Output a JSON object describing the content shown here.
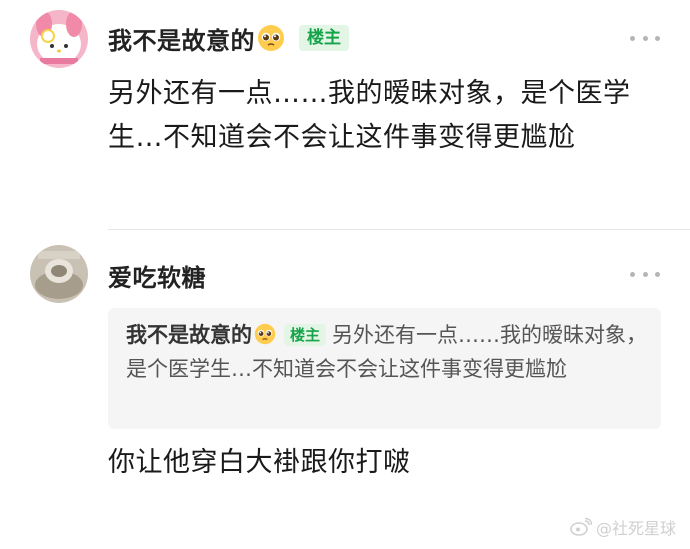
{
  "comments": [
    {
      "username": "我不是故意的",
      "emoji": "pleading-face",
      "badge": "楼主",
      "text": "另外还有一点……我的暧昧对象，是个医学生…不知道会不会让这件事变得更尴尬"
    },
    {
      "username": "爱吃软糖",
      "quote": {
        "username": "我不是故意的",
        "emoji": "pleading-face",
        "badge": "楼主",
        "text": "另外还有一点……我的暧昧对象，是个医学生…不知道会不会让这件事变得更尴尬"
      },
      "text": "你让他穿白大褂跟你打啵"
    }
  ],
  "watermark": "@社死星球",
  "colors": {
    "badge_bg": "#e3f6e6",
    "badge_text": "#17a34a",
    "quote_bg": "#f5f5f5"
  }
}
